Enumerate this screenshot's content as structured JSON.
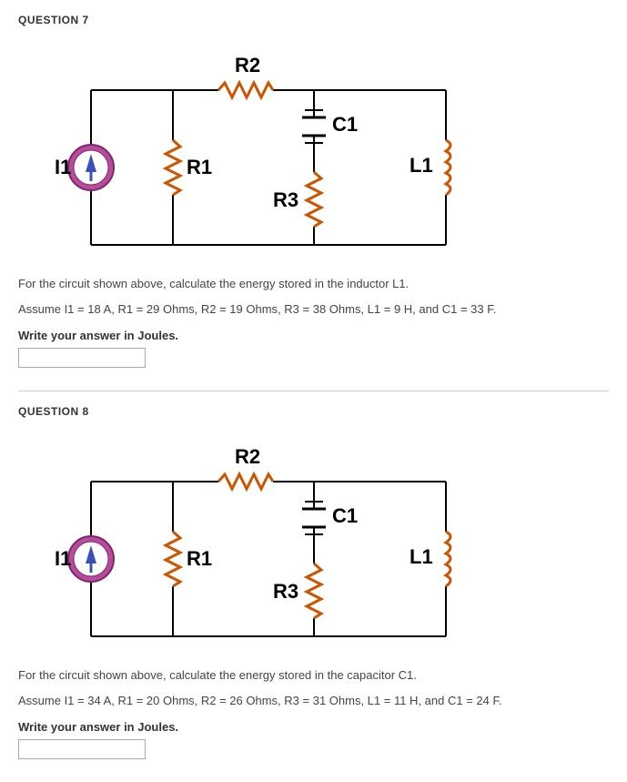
{
  "q7": {
    "header": "QUESTION 7",
    "circuit": {
      "I1": "I1",
      "R1": "R1",
      "R2": "R2",
      "R3": "R3",
      "C1": "C1",
      "L1": "L1"
    },
    "text1": "For the circuit shown above, calculate the energy stored in the inductor L1.",
    "text2": "Assume I1 = 18 A, R1 = 29 Ohms, R2 = 19 Ohms, R3 = 38 Ohms, L1 = 9 H, and C1 = 33 F.",
    "prompt": "Write your answer in Joules.",
    "answer": ""
  },
  "q8": {
    "header": "QUESTION 8",
    "circuit": {
      "I1": "I1",
      "R1": "R1",
      "R2": "R2",
      "R3": "R3",
      "C1": "C1",
      "L1": "L1"
    },
    "text1": "For the circuit shown above, calculate the energy stored in the capacitor C1.",
    "text2": "Assume I1 = 34 A, R1 = 20 Ohms, R2 = 26 Ohms, R3 = 31 Ohms, L1 = 11 H, and C1 = 24 F.",
    "prompt": "Write your answer in Joules.",
    "answer": ""
  }
}
